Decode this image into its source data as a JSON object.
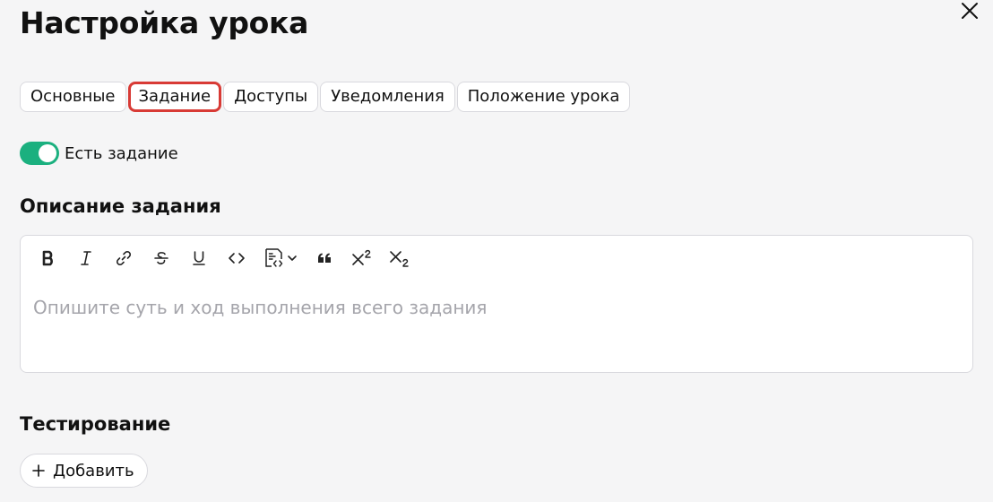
{
  "header": {
    "title": "Настройка урока"
  },
  "tabs": [
    {
      "label": "Основные",
      "active": false
    },
    {
      "label": "Задание",
      "active": true
    },
    {
      "label": "Доступы",
      "active": false
    },
    {
      "label": "Уведомления",
      "active": false
    },
    {
      "label": "Положение урока",
      "active": false
    }
  ],
  "task_toggle": {
    "label": "Есть задание",
    "enabled": true
  },
  "description": {
    "title": "Описание задания",
    "placeholder": "Опишите суть и ход выполнения всего задания",
    "toolbar": [
      "bold-icon",
      "italic-icon",
      "link-icon",
      "strikethrough-icon",
      "underline-icon",
      "code-icon",
      "code-block-icon",
      "quote-icon",
      "superscript-icon",
      "subscript-icon"
    ]
  },
  "testing": {
    "title": "Тестирование",
    "add_label": "Добавить"
  },
  "colors": {
    "accent": "#1bb07f",
    "highlight": "#d83a35",
    "placeholder": "#a5a5ab"
  }
}
